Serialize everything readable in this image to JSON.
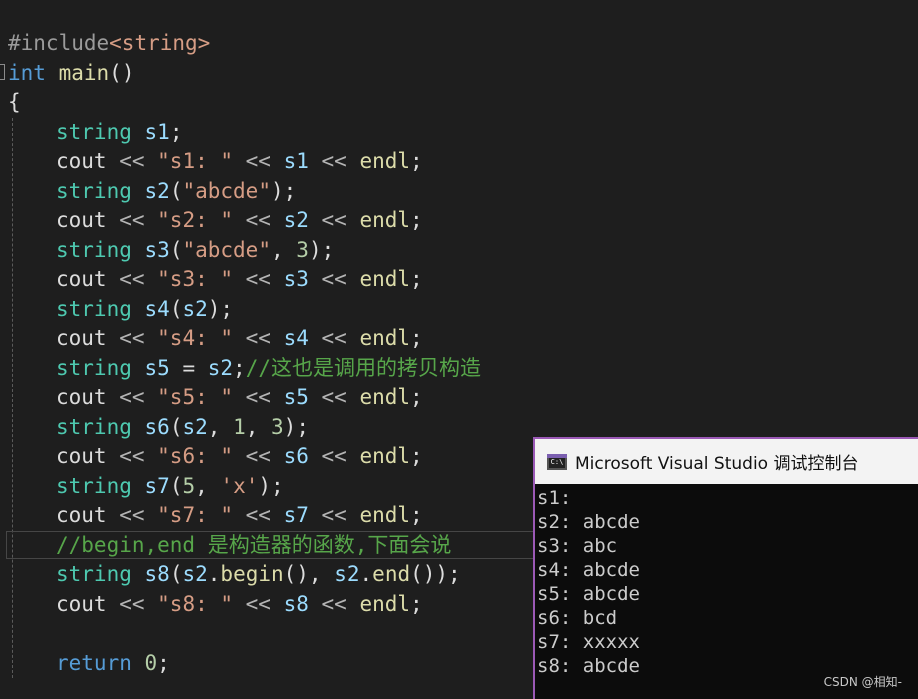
{
  "editor": {
    "lines": [
      {
        "tokens": [
          {
            "t": "#include",
            "c": "pp"
          },
          {
            "t": "<string>",
            "c": "st"
          }
        ]
      },
      {
        "tokens": [
          {
            "t": "int",
            "c": "kw"
          },
          {
            "t": " ",
            "c": ""
          },
          {
            "t": "main",
            "c": "fn"
          },
          {
            "t": "()",
            "c": ""
          }
        ]
      },
      {
        "tokens": [
          {
            "t": "{",
            "c": ""
          }
        ]
      },
      {
        "tokens": [
          {
            "t": "string",
            "c": "ty"
          },
          {
            "t": " ",
            "c": ""
          },
          {
            "t": "s1",
            "c": "va"
          },
          {
            "t": ";",
            "c": ""
          }
        ]
      },
      {
        "tokens": [
          {
            "t": "cout",
            "c": ""
          },
          {
            "t": " << ",
            "c": "op"
          },
          {
            "t": "\"s1: \"",
            "c": "st"
          },
          {
            "t": " << ",
            "c": "op"
          },
          {
            "t": "s1",
            "c": "va"
          },
          {
            "t": " << ",
            "c": "op"
          },
          {
            "t": "endl",
            "c": "fn"
          },
          {
            "t": ";",
            "c": ""
          }
        ]
      },
      {
        "tokens": [
          {
            "t": "string",
            "c": "ty"
          },
          {
            "t": " ",
            "c": ""
          },
          {
            "t": "s2",
            "c": "va"
          },
          {
            "t": "(",
            "c": ""
          },
          {
            "t": "\"abcde\"",
            "c": "st"
          },
          {
            "t": ");",
            "c": ""
          }
        ]
      },
      {
        "tokens": [
          {
            "t": "cout",
            "c": ""
          },
          {
            "t": " << ",
            "c": "op"
          },
          {
            "t": "\"s2: \"",
            "c": "st"
          },
          {
            "t": " << ",
            "c": "op"
          },
          {
            "t": "s2",
            "c": "va"
          },
          {
            "t": " << ",
            "c": "op"
          },
          {
            "t": "endl",
            "c": "fn"
          },
          {
            "t": ";",
            "c": ""
          }
        ]
      },
      {
        "tokens": [
          {
            "t": "string",
            "c": "ty"
          },
          {
            "t": " ",
            "c": ""
          },
          {
            "t": "s3",
            "c": "va"
          },
          {
            "t": "(",
            "c": ""
          },
          {
            "t": "\"abcde\"",
            "c": "st"
          },
          {
            "t": ", ",
            "c": ""
          },
          {
            "t": "3",
            "c": "nu"
          },
          {
            "t": ");",
            "c": ""
          }
        ]
      },
      {
        "tokens": [
          {
            "t": "cout",
            "c": ""
          },
          {
            "t": " << ",
            "c": "op"
          },
          {
            "t": "\"s3: \"",
            "c": "st"
          },
          {
            "t": " << ",
            "c": "op"
          },
          {
            "t": "s3",
            "c": "va"
          },
          {
            "t": " << ",
            "c": "op"
          },
          {
            "t": "endl",
            "c": "fn"
          },
          {
            "t": ";",
            "c": ""
          }
        ]
      },
      {
        "tokens": [
          {
            "t": "string",
            "c": "ty"
          },
          {
            "t": " ",
            "c": ""
          },
          {
            "t": "s4",
            "c": "va"
          },
          {
            "t": "(",
            "c": ""
          },
          {
            "t": "s2",
            "c": "va"
          },
          {
            "t": ");",
            "c": ""
          }
        ]
      },
      {
        "tokens": [
          {
            "t": "cout",
            "c": ""
          },
          {
            "t": " << ",
            "c": "op"
          },
          {
            "t": "\"s4: \"",
            "c": "st"
          },
          {
            "t": " << ",
            "c": "op"
          },
          {
            "t": "s4",
            "c": "va"
          },
          {
            "t": " << ",
            "c": "op"
          },
          {
            "t": "endl",
            "c": "fn"
          },
          {
            "t": ";",
            "c": ""
          }
        ]
      },
      {
        "tokens": [
          {
            "t": "string",
            "c": "ty"
          },
          {
            "t": " ",
            "c": ""
          },
          {
            "t": "s5",
            "c": "va"
          },
          {
            "t": " = ",
            "c": ""
          },
          {
            "t": "s2",
            "c": "va"
          },
          {
            "t": ";",
            "c": ""
          },
          {
            "t": "//这也是调用的拷贝构造",
            "c": "cm"
          }
        ]
      },
      {
        "tokens": [
          {
            "t": "cout",
            "c": ""
          },
          {
            "t": " << ",
            "c": "op"
          },
          {
            "t": "\"s5: \"",
            "c": "st"
          },
          {
            "t": " << ",
            "c": "op"
          },
          {
            "t": "s5",
            "c": "va"
          },
          {
            "t": " << ",
            "c": "op"
          },
          {
            "t": "endl",
            "c": "fn"
          },
          {
            "t": ";",
            "c": ""
          }
        ]
      },
      {
        "tokens": [
          {
            "t": "string",
            "c": "ty"
          },
          {
            "t": " ",
            "c": ""
          },
          {
            "t": "s6",
            "c": "va"
          },
          {
            "t": "(",
            "c": ""
          },
          {
            "t": "s2",
            "c": "va"
          },
          {
            "t": ", ",
            "c": ""
          },
          {
            "t": "1",
            "c": "nu"
          },
          {
            "t": ", ",
            "c": ""
          },
          {
            "t": "3",
            "c": "nu"
          },
          {
            "t": ");",
            "c": ""
          }
        ]
      },
      {
        "tokens": [
          {
            "t": "cout",
            "c": ""
          },
          {
            "t": " << ",
            "c": "op"
          },
          {
            "t": "\"s6: \"",
            "c": "st"
          },
          {
            "t": " << ",
            "c": "op"
          },
          {
            "t": "s6",
            "c": "va"
          },
          {
            "t": " << ",
            "c": "op"
          },
          {
            "t": "endl",
            "c": "fn"
          },
          {
            "t": ";",
            "c": ""
          }
        ]
      },
      {
        "tokens": [
          {
            "t": "string",
            "c": "ty"
          },
          {
            "t": " ",
            "c": ""
          },
          {
            "t": "s7",
            "c": "va"
          },
          {
            "t": "(",
            "c": ""
          },
          {
            "t": "5",
            "c": "nu"
          },
          {
            "t": ", ",
            "c": ""
          },
          {
            "t": "'x'",
            "c": "st"
          },
          {
            "t": ");",
            "c": ""
          }
        ]
      },
      {
        "tokens": [
          {
            "t": "cout",
            "c": ""
          },
          {
            "t": " << ",
            "c": "op"
          },
          {
            "t": "\"s7: \"",
            "c": "st"
          },
          {
            "t": " << ",
            "c": "op"
          },
          {
            "t": "s7",
            "c": "va"
          },
          {
            "t": " << ",
            "c": "op"
          },
          {
            "t": "endl",
            "c": "fn"
          },
          {
            "t": ";",
            "c": ""
          }
        ]
      },
      {
        "tokens": [
          {
            "t": "//begin,end 是构造器的函数,下面会说",
            "c": "cm"
          }
        ]
      },
      {
        "tokens": [
          {
            "t": "string",
            "c": "ty"
          },
          {
            "t": " ",
            "c": ""
          },
          {
            "t": "s8",
            "c": "va"
          },
          {
            "t": "(",
            "c": ""
          },
          {
            "t": "s2",
            "c": "va"
          },
          {
            "t": ".",
            "c": ""
          },
          {
            "t": "begin",
            "c": "fn"
          },
          {
            "t": "(), ",
            "c": ""
          },
          {
            "t": "s2",
            "c": "va"
          },
          {
            "t": ".",
            "c": ""
          },
          {
            "t": "end",
            "c": "fn"
          },
          {
            "t": "());",
            "c": ""
          }
        ]
      },
      {
        "tokens": [
          {
            "t": "cout",
            "c": ""
          },
          {
            "t": " << ",
            "c": "op"
          },
          {
            "t": "\"s8: \"",
            "c": "st"
          },
          {
            "t": " << ",
            "c": "op"
          },
          {
            "t": "s8",
            "c": "va"
          },
          {
            "t": " << ",
            "c": "op"
          },
          {
            "t": "endl",
            "c": "fn"
          },
          {
            "t": ";",
            "c": ""
          }
        ]
      },
      {
        "tokens": []
      },
      {
        "tokens": [
          {
            "t": "return",
            "c": "kw"
          },
          {
            "t": " ",
            "c": ""
          },
          {
            "t": "0",
            "c": "nu"
          },
          {
            "t": ";",
            "c": ""
          }
        ]
      }
    ]
  },
  "console": {
    "title": "Microsoft Visual Studio 调试控制台",
    "icon_label": "C:\\",
    "output": [
      "s1:",
      "s2: abcde",
      "s3: abc",
      "s4: abcde",
      "s5: abcde",
      "s6: bcd",
      "s7: xxxxx",
      "s8: abcde"
    ]
  },
  "watermark": "CSDN @相知-",
  "colors": {
    "background": "#1e1e1e",
    "keyword": "#569cd6",
    "type": "#4ec9b0",
    "function": "#dcdcaa",
    "string": "#d69d85",
    "number": "#b5cea8",
    "variable": "#9cdcfe",
    "comment": "#57a64a",
    "console_border": "#9b59b6"
  }
}
